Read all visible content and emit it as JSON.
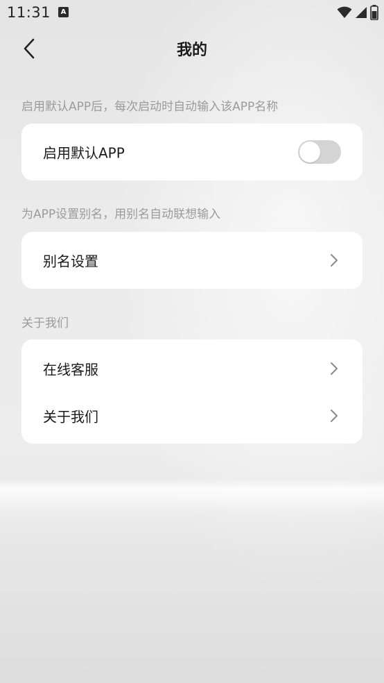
{
  "status_bar": {
    "time": "11:31",
    "app_icon_letter": "A",
    "icons": [
      "wifi-icon",
      "signal-icon",
      "battery-icon"
    ]
  },
  "header": {
    "title": "我的",
    "back_icon": "chevron-left-icon"
  },
  "sections": {
    "default_app": {
      "caption": "启用默认APP后，每次启动时自动输入该APP名称",
      "toggle_label": "启用默认APP",
      "toggle_on": false
    },
    "alias": {
      "caption": "为APP设置别名，用别名自动联想输入",
      "row_label": "别名设置"
    },
    "about": {
      "caption": "关于我们",
      "rows": [
        {
          "label": "在线客服"
        },
        {
          "label": "关于我们"
        }
      ]
    }
  },
  "colors": {
    "caption": "#9b9b9b",
    "card": "#ffffff",
    "toggle_off": "#d4d4d4",
    "chevron": "#8a8a8a"
  }
}
